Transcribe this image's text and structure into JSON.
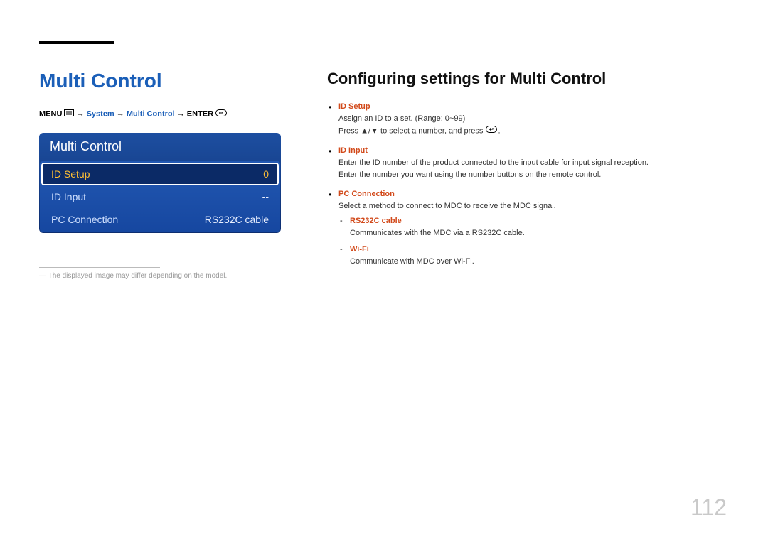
{
  "page_number": "112",
  "left": {
    "title": "Multi Control",
    "breadcrumb": {
      "menu": "MENU",
      "arrow": " → ",
      "system": "System",
      "multi": "Multi Control",
      "enter": "ENTER"
    },
    "osd": {
      "header": "Multi Control",
      "rows": [
        {
          "label": "ID Setup",
          "value": "0",
          "selected": true
        },
        {
          "label": "ID Input",
          "value": "--",
          "selected": false
        },
        {
          "label": "PC Connection",
          "value": "RS232C cable",
          "selected": false
        }
      ]
    },
    "footnote": "The displayed image may differ depending on the model."
  },
  "right": {
    "title": "Configuring settings for Multi Control",
    "items": [
      {
        "term": "ID Setup",
        "lines": [
          "Assign an ID to a set. (Range: 0~99)",
          "Press ▲/▼ to select a number, and press"
        ],
        "has_enter_icon_at_end": true
      },
      {
        "term": "ID Input",
        "lines": [
          "Enter the ID number of the product connected to the input cable for input signal reception.",
          "Enter the number you want using the number buttons on the remote control."
        ]
      },
      {
        "term": "PC Connection",
        "lines": [
          "Select a method to connect to MDC to receive the MDC signal."
        ],
        "subitems": [
          {
            "term": "RS232C cable",
            "line": "Communicates with the MDC via a RS232C cable."
          },
          {
            "term": "Wi-Fi",
            "line": "Communicate with MDC over Wi-Fi."
          }
        ]
      }
    ]
  }
}
